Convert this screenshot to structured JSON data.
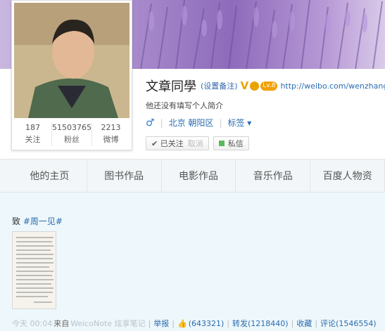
{
  "profile": {
    "name": "文章同學",
    "remark_label": "(设置备注)",
    "verified_badge": "V",
    "level_badge": "Lv.8",
    "url": "http://weibo.com/wenzhang",
    "bio": "他还没有填写个人简介",
    "gender_icon": "male-icon",
    "gender_symbol": "♂",
    "location": "北京 朝阳区",
    "tags_label": "标签 ▾",
    "stats": [
      {
        "value": "187",
        "label": "关注"
      },
      {
        "value": "51503765",
        "label": "粉丝"
      },
      {
        "value": "2213",
        "label": "微博"
      }
    ],
    "followed_label": "✔ 已关注",
    "unfollow_label": "取消",
    "message_label": "私信"
  },
  "tabs": [
    {
      "label": "他的主页"
    },
    {
      "label": "图书作品"
    },
    {
      "label": "电影作品"
    },
    {
      "label": "音乐作品"
    },
    {
      "label": "百度人物资"
    }
  ],
  "post": {
    "text_prefix": "致 ",
    "topic": "#周一见#",
    "time": "今天 00:04",
    "from_label": "来自",
    "source": "WeicoNote 炫享笔记",
    "report_label": "举报",
    "likes": "(643321)",
    "repost_label": "转发(1218440)",
    "favorite_label": "收藏",
    "comment_label": "评论(1546554)"
  },
  "colors": {
    "link": "#2a6cb0",
    "banner": "#8e6bbb",
    "page_bg": "#eef7fb"
  }
}
